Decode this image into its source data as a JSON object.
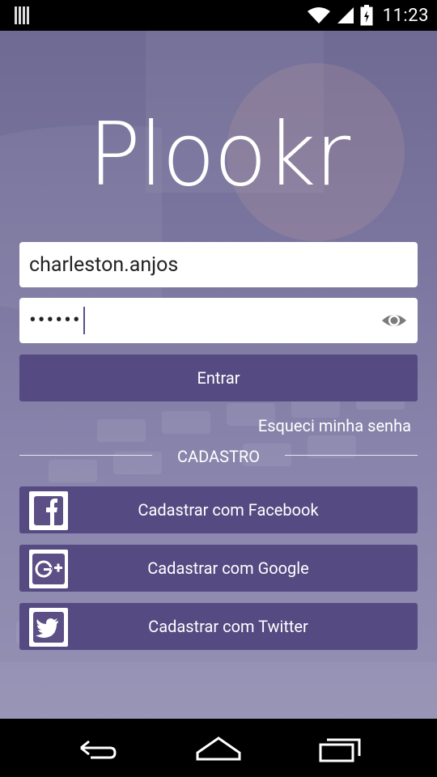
{
  "status_bar": {
    "time": "11:23"
  },
  "app": {
    "logo_text": "Plookr"
  },
  "login": {
    "username_value": "charleston.anjos",
    "password_masked": "••••••",
    "login_button": "Entrar",
    "forgot_link": "Esqueci minha senha"
  },
  "signup": {
    "section_label": "CADASTRO",
    "facebook_label": "Cadastrar com Facebook",
    "google_label": "Cadastrar com Google",
    "twitter_label": "Cadastrar com Twitter"
  },
  "colors": {
    "button_bg": "#564a82",
    "background": "#7c77a0",
    "cursor": "#5a4e8c"
  },
  "icons": {
    "status": [
      "sim-icon",
      "wifi-icon",
      "signal-icon",
      "battery-icon"
    ],
    "nav": [
      "back-icon",
      "home-icon",
      "recents-icon"
    ]
  }
}
